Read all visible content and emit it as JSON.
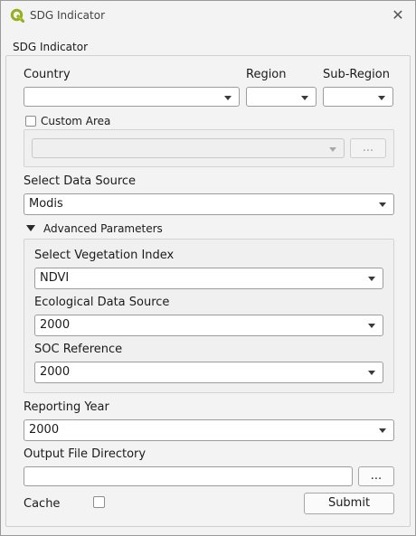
{
  "window": {
    "title": "SDG Indicator",
    "close_glyph": "✕"
  },
  "group": {
    "title": "SDG Indicator"
  },
  "location": {
    "country_label": "Country",
    "country_value": "",
    "region_label": "Region",
    "region_value": "",
    "subregion_label": "Sub-Region",
    "subregion_value": "",
    "custom_area_label": "Custom Area",
    "custom_area_checked": false,
    "custom_area_value": "",
    "custom_area_browse": "..."
  },
  "data_source": {
    "label": "Select Data Source",
    "value": "Modis"
  },
  "advanced": {
    "label": "Advanced Parameters",
    "vegetation_index_label": "Select Vegetation Index",
    "vegetation_index_value": "NDVI",
    "ecological_source_label": "Ecological Data Source",
    "ecological_source_value": "2000",
    "soc_reference_label": "SOC Reference",
    "soc_reference_value": "2000"
  },
  "reporting": {
    "label": "Reporting Year",
    "value": "2000"
  },
  "output": {
    "label": "Output File Directory",
    "value": "",
    "browse": "..."
  },
  "cache": {
    "label": "Cache",
    "checked": false
  },
  "submit": {
    "label": "Submit"
  },
  "colors": {
    "qgis_green": "#93b023",
    "qgis_yellow": "#f0c419",
    "window_bg": "#f3f3f3"
  }
}
